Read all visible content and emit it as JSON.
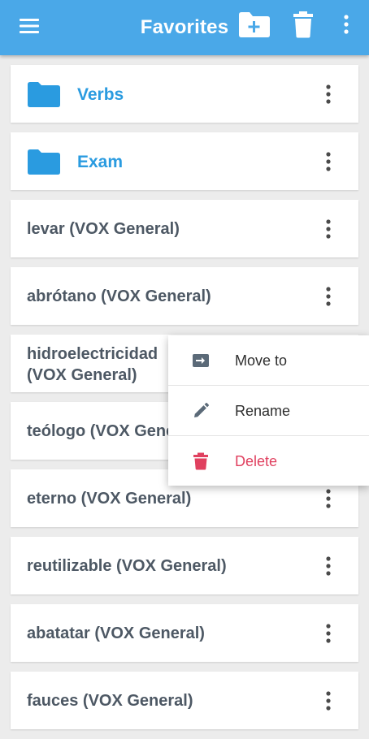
{
  "appbar": {
    "title": "Favorites"
  },
  "folders": [
    {
      "label": "Verbs"
    },
    {
      "label": "Exam"
    }
  ],
  "entries": [
    {
      "label": "levar (VOX General)"
    },
    {
      "label": "abrótano (VOX General)"
    },
    {
      "label": "hidroelectricidad (VOX General)"
    },
    {
      "label": "teólogo (VOX General)"
    },
    {
      "label": "eterno (VOX General)"
    },
    {
      "label": "reutilizable (VOX General)"
    },
    {
      "label": "abatatar (VOX General)"
    },
    {
      "label": "fauces (VOX General)"
    }
  ],
  "context_menu": {
    "move_label": "Move to",
    "rename_label": "Rename",
    "delete_label": "Delete"
  },
  "colors": {
    "appbar": "#4aa8e8",
    "folder": "#2a9be0",
    "item_text": "#4d5864",
    "danger": "#e0405f"
  },
  "icons": {
    "menu": "hamburger-menu-icon",
    "new_folder": "new-folder-icon",
    "trash": "trash-icon",
    "more": "more-vertical-icon",
    "folder": "folder-icon",
    "move": "move-to-icon",
    "rename": "pencil-icon",
    "delete": "delete-icon"
  }
}
